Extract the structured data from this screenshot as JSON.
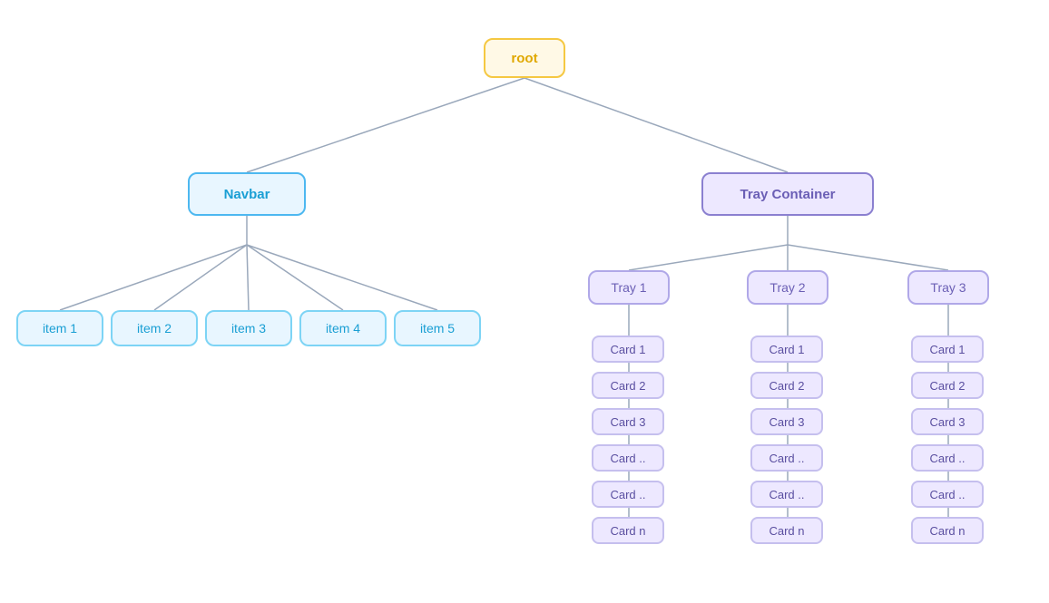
{
  "nodes": {
    "root": {
      "label": "root"
    },
    "navbar": {
      "label": "Navbar"
    },
    "tray_container": {
      "label": "Tray Container"
    },
    "items": [
      "item 1",
      "item 2",
      "item 3",
      "item 4",
      "item 5"
    ],
    "trays": [
      "Tray 1",
      "Tray 2",
      "Tray 3"
    ],
    "cards": [
      "Card 1",
      "Card 2",
      "Card 3",
      "Card ..",
      "Card ..",
      "Card n"
    ]
  }
}
